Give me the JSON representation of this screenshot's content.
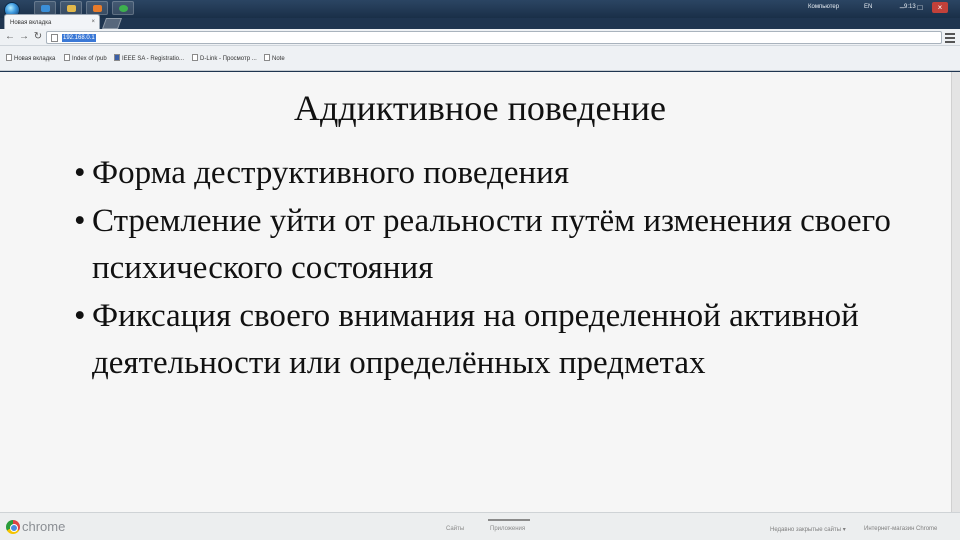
{
  "taskbar": {
    "tray_text": "Компьютер",
    "lang": "EN",
    "clock": "9:13",
    "icons": [
      "start-orb",
      "ie-icon",
      "folder-icon",
      "media-icon",
      "chrome-icon"
    ]
  },
  "tab": {
    "title": "Новая вкладка",
    "close": "×"
  },
  "toolbar": {
    "url": "192.168.0.1",
    "back": "←",
    "forward": "→",
    "reload": "↻"
  },
  "bookmarks": [
    {
      "label": "Новая вкладка"
    },
    {
      "label": "Index of /pub"
    },
    {
      "label": "IEEE SA - Registratio..."
    },
    {
      "label": "D-Link - Просмотр ..."
    },
    {
      "label": "Note"
    }
  ],
  "slide": {
    "title": "Аддиктивное поведение",
    "bullets": [
      "Форма деструктивного поведения",
      "Стремление уйти от реальности путём изменения своего психического состояния",
      "Фиксация своего внимания на определенной активной деятельности или определённых предметах"
    ]
  },
  "bottom": {
    "brand": "chrome",
    "tabs": [
      "Сайты",
      "Приложения"
    ],
    "recent": "Недавно закрытые сайты ▾",
    "store": "Интернет-магазин Chrome"
  },
  "colors": {
    "url_highlight": "#3a78d6",
    "page_bg": "#f6f6f6",
    "taskbar": "#1f3550"
  }
}
